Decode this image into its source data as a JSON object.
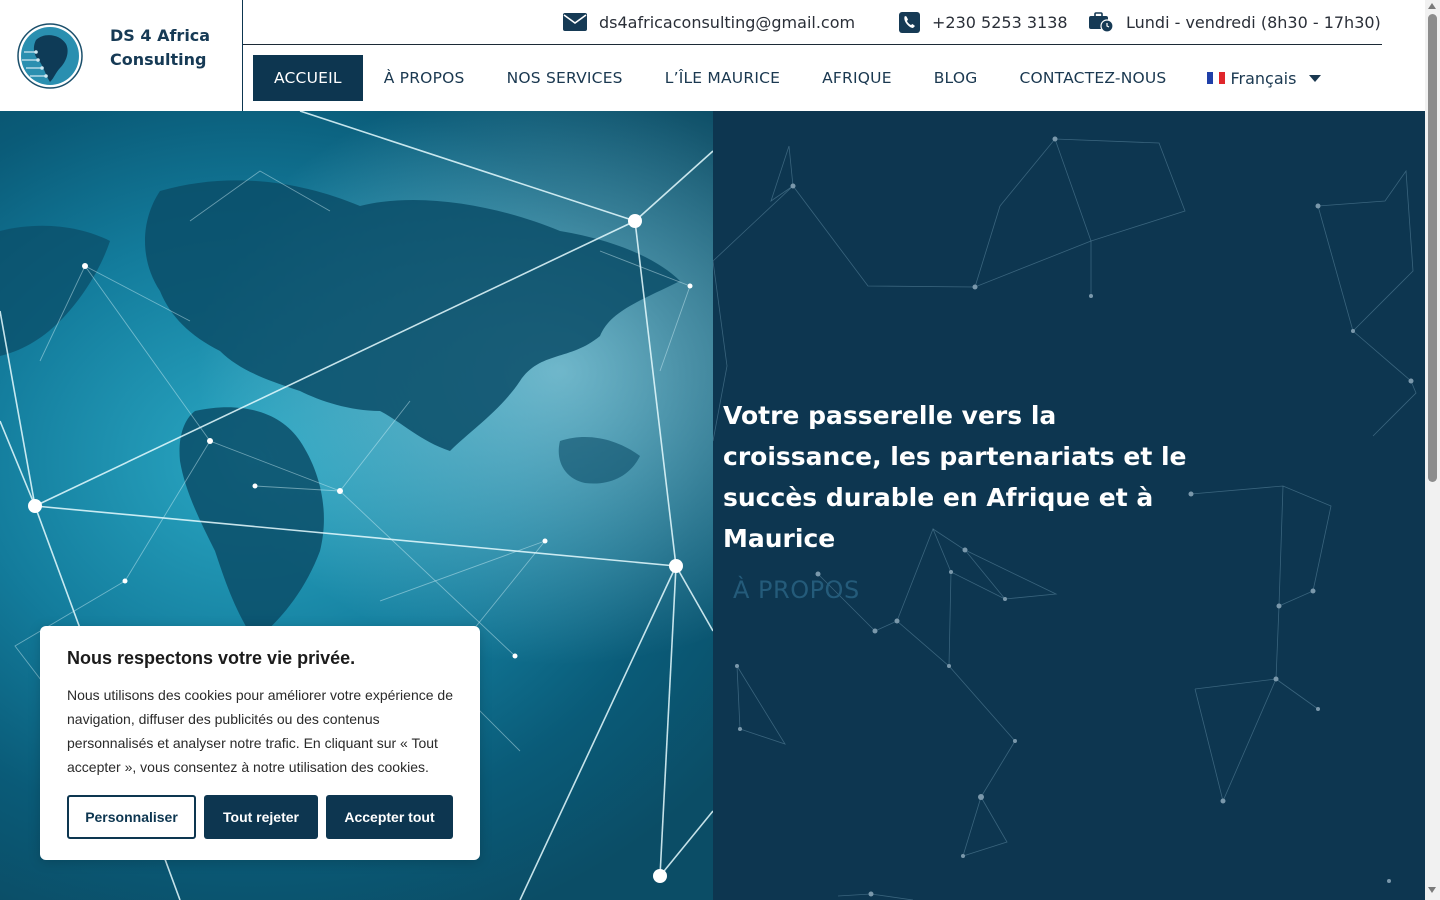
{
  "brand": {
    "name_line1": "DS 4 Africa",
    "name_line2": "Consulting"
  },
  "topbar": {
    "email": "ds4africaconsulting@gmail.com",
    "phone": "+230 5253 3138",
    "hours": "Lundi - vendredi (8h30 - 17h30)"
  },
  "nav": {
    "items": [
      "ACCUEIL",
      "À PROPOS",
      "NOS SERVICES",
      "L’ÎLE MAURICE",
      "AFRIQUE",
      "BLOG",
      "CONTACTEZ-NOUS"
    ],
    "active": "ACCUEIL",
    "language": "Français"
  },
  "hero": {
    "title": "Votre passerelle vers la croissance, les partenariats et le succès durable en Afrique et à Maurice",
    "button": "À PROPOS"
  },
  "cookie": {
    "title": "Nous respectons votre vie privée.",
    "text": "Nous utilisons des cookies pour améliorer votre expérience de navigation, diffuser des publicités ou des contenus personnalisés et analyser notre trafic. En cliquant sur « Tout accepter », vous consentez à notre utilisation des cookies.",
    "buttons": {
      "customize": "Personnaliser",
      "reject": "Tout rejeter",
      "accept": "Accepter tout"
    }
  },
  "colors": {
    "primary": "#0d3650",
    "hero_bg": "#0d3650",
    "text_dark": "#163a55"
  },
  "icons": {
    "email": "envelope-icon",
    "phone": "phone-icon",
    "hours": "briefcase-clock-icon",
    "flag": "france-flag-icon"
  }
}
